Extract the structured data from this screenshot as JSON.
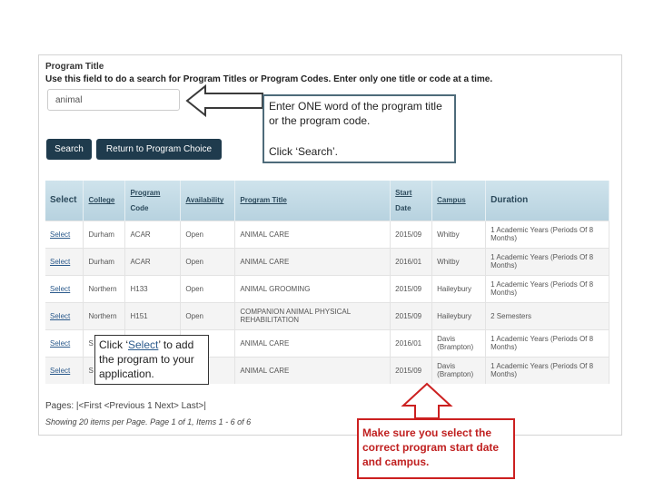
{
  "form": {
    "field_title": "Program Title",
    "field_description": "Use this field to do a search for Program Titles or Program Codes. Enter only one title or code at a time.",
    "search_value": "animal",
    "search_button": "Search",
    "return_button": "Return to Program Choice"
  },
  "table": {
    "headers": {
      "select": "Select",
      "college": "College",
      "program_code_1": "Program",
      "program_code_2": "Code",
      "availability": "Availability",
      "program_title": "Program Title",
      "start_date_1": "Start",
      "start_date_2": "Date",
      "campus": "Campus",
      "duration": "Duration"
    },
    "rows": [
      {
        "select": "Select",
        "college": "Durham",
        "code": "ACAR",
        "availability": "Open",
        "title": "ANIMAL CARE",
        "start": "2015/09",
        "campus": "Whitby",
        "duration": "1 Academic Years (Periods Of 8 Months)"
      },
      {
        "select": "Select",
        "college": "Durham",
        "code": "ACAR",
        "availability": "Open",
        "title": "ANIMAL CARE",
        "start": "2016/01",
        "campus": "Whitby",
        "duration": "1 Academic Years (Periods Of 8 Months)"
      },
      {
        "select": "Select",
        "college": "Northern",
        "code": "H133",
        "availability": "Open",
        "title": "ANIMAL GROOMING",
        "start": "2015/09",
        "campus": "Haileybury",
        "duration": "1 Academic Years (Periods Of 8 Months)"
      },
      {
        "select": "Select",
        "college": "Northern",
        "code": "H151",
        "availability": "Open",
        "title": "COMPANION ANIMAL PHYSICAL REHABILITATION",
        "start": "2015/09",
        "campus": "Haileybury",
        "duration": "2 Semesters"
      },
      {
        "select": "Select",
        "college": "S",
        "code": "",
        "availability": "",
        "title": "ANIMAL CARE",
        "start": "2016/01",
        "campus": "Davis (Brampton)",
        "duration": "1 Academic Years (Periods Of 8 Months)"
      },
      {
        "select": "Select",
        "college": "S",
        "code": "",
        "availability": "",
        "title": "ANIMAL CARE",
        "start": "2015/09",
        "campus": "Davis (Brampton)",
        "duration": "1 Academic Years (Periods Of 8 Months)"
      }
    ]
  },
  "pager": {
    "text": "Pages: |<First <Previous 1 Next> Last>|",
    "summary": "Showing 20 items per Page. Page 1 of 1, Items 1 - 6 of 6"
  },
  "callouts": {
    "search_line1": "Enter ONE word of the program title or the program code.",
    "search_line2": "Click ‘Search’.",
    "select_prefix": "Click ‘",
    "select_word": "Select",
    "select_suffix": "’ to add the program to your application.",
    "date_note": "Make sure you select the correct program start date and campus."
  },
  "colors": {
    "button_bg": "#1f3b4d",
    "header_bg": "#b7d2df",
    "arrow_dark": "#3a3a3a",
    "arrow_red": "#cc2020",
    "callout_border": "#4e6b7a"
  }
}
